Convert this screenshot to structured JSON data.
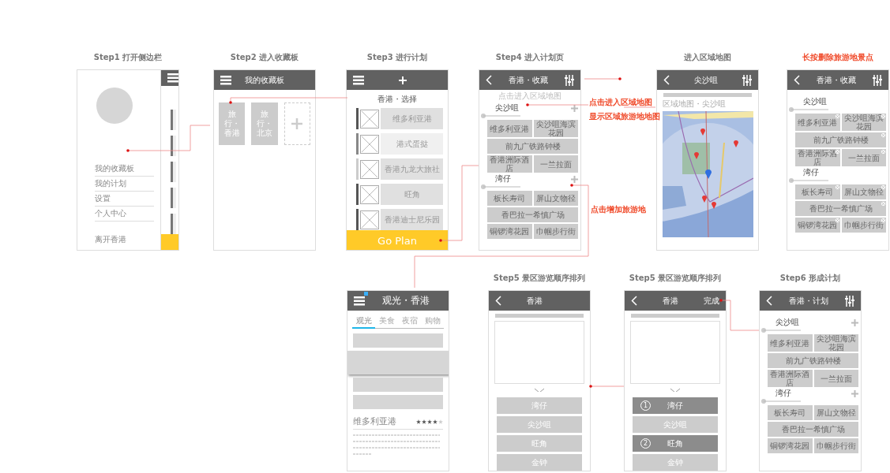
{
  "screens": [
    {
      "kind": "sidebar",
      "caption": "Step1  打开侧边栏",
      "menu": [
        "我的收藏板",
        "我的计划",
        "设置",
        "个人中心"
      ],
      "footer": "离开香港"
    },
    {
      "kind": "boards",
      "caption": "Step2  进入收藏板",
      "title": "我的收藏板",
      "boards": [
        "旅行・香港",
        "旅行・北京"
      ]
    },
    {
      "kind": "select",
      "caption": "Step3  进行计划",
      "subtitle": "香港・选择",
      "button": "Go Plan",
      "items": [
        {
          "label": "维多利亚港",
          "color": "#555555"
        },
        {
          "label": "港式蛋挞",
          "color": "#888888"
        },
        {
          "label": "香港九龙大旅社",
          "color": "#cccccc"
        },
        {
          "label": "旺角",
          "color": "#555555"
        },
        {
          "label": "香港迪士尼乐园",
          "color": "#555555"
        }
      ]
    },
    {
      "kind": "plan",
      "caption": "Step4  进入计划页",
      "highlight": false,
      "title": "香港・收藏",
      "hint": "点击进入区域地图",
      "add_buttons": true,
      "deletable": false,
      "areas": [
        {
          "name": "尖沙咀",
          "rows": [
            [
              "维多利亚港",
              "尖沙咀海滨花园"
            ],
            [
              "前九广铁路钟楼"
            ],
            [
              "香港洲际酒店",
              "一兰拉面"
            ]
          ]
        },
        {
          "name": "湾仔",
          "rows": [
            [
              "板长寿司",
              "屏山文物径"
            ],
            [
              "香巴拉一希慎广场"
            ],
            [
              "铜锣湾花园",
              "巾帼步行街"
            ]
          ]
        }
      ]
    },
    {
      "kind": "map",
      "caption": "进入区域地图",
      "highlight": false,
      "title": "尖沙咀",
      "breadcrumb": "区域地图・尖沙咀"
    },
    {
      "kind": "plan",
      "caption": "长按删除旅游地景点",
      "highlight": true,
      "title": "香港・收藏",
      "add_buttons": false,
      "deletable": true,
      "areas": [
        {
          "name": "尖沙咀",
          "rows": [
            [
              "维多利亚港",
              "尖沙咀海滨花园"
            ],
            [
              "前九广铁路钟楼"
            ],
            [
              "香港洲际酒店",
              "一兰拉面"
            ]
          ]
        },
        {
          "name": "湾仔",
          "rows": [
            [
              "板长寿司",
              "屏山文物径"
            ],
            [
              "香巴拉一希慎广场"
            ],
            [
              "铜锣湾花园",
              "巾帼步行街"
            ]
          ]
        }
      ]
    },
    {
      "kind": "category",
      "title": "观光・香港",
      "tabs": [
        {
          "label": "观光",
          "selected": true
        },
        {
          "label": "美食",
          "selected": false
        },
        {
          "label": "夜宿",
          "selected": false
        },
        {
          "label": "购物",
          "selected": false
        }
      ],
      "place": "维多利亚港",
      "stars": 4
    },
    {
      "kind": "order",
      "caption": "Step5 景区游览顺序排列",
      "title": "香港",
      "stops": [
        {
          "label": "湾仔",
          "selected": false
        },
        {
          "label": "尖沙咀",
          "selected": false
        },
        {
          "label": "旺角",
          "selected": false
        },
        {
          "label": "金钟",
          "selected": false
        }
      ]
    },
    {
      "kind": "order",
      "caption": "Step5 景区游览顺序排列",
      "title": "香港",
      "done": "完成",
      "stops": [
        {
          "label": "湾仔",
          "selected": true,
          "number": "1"
        },
        {
          "label": "尖沙咀",
          "selected": false
        },
        {
          "label": "旺角",
          "selected": true,
          "number": "2"
        },
        {
          "label": "金钟",
          "selected": false
        }
      ]
    },
    {
      "kind": "plan",
      "caption": "Step6 形成计划",
      "highlight": false,
      "title": "香港・计划",
      "add_buttons": true,
      "deletable": false,
      "areas": [
        {
          "name": "尖沙咀",
          "rows": [
            [
              "维多利亚港",
              "尖沙咀海滨花园"
            ],
            [
              "前九广铁路钟楼"
            ],
            [
              "香港洲际酒店",
              "一兰拉面"
            ]
          ]
        },
        {
          "name": "湾仔",
          "rows": [
            [
              "板长寿司",
              "屏山文物径"
            ],
            [
              "香巴拉一希慎广场"
            ],
            [
              "铜锣湾花园",
              "巾帼步行街"
            ]
          ]
        }
      ]
    }
  ],
  "annotations": [
    "点击进入区域地图",
    "显示区域旅游地地图",
    "点击增加旅游地"
  ]
}
